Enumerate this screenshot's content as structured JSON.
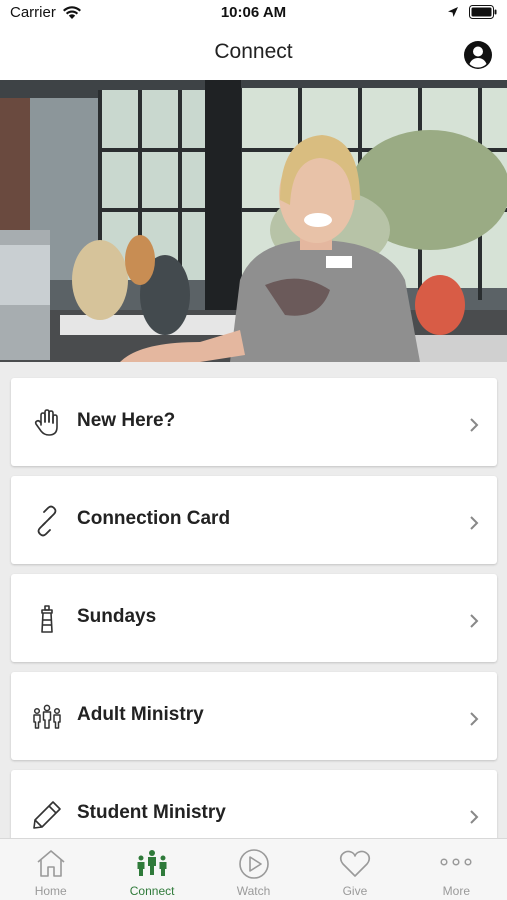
{
  "status": {
    "carrier": "Carrier",
    "time": "10:06 AM"
  },
  "header": {
    "title": "Connect"
  },
  "cards": [
    {
      "label": "New Here?",
      "icon": "hand-icon"
    },
    {
      "label": "Connection Card",
      "icon": "link-icon"
    },
    {
      "label": "Sundays",
      "icon": "lighthouse-icon"
    },
    {
      "label": "Adult Ministry",
      "icon": "people-group-icon"
    },
    {
      "label": "Student Ministry",
      "icon": "pencil-icon"
    }
  ],
  "tabs": [
    {
      "label": "Home",
      "icon": "home-icon",
      "active": false
    },
    {
      "label": "Connect",
      "icon": "connect-people-icon",
      "active": true
    },
    {
      "label": "Watch",
      "icon": "play-icon",
      "active": false
    },
    {
      "label": "Give",
      "icon": "heart-icon",
      "active": false
    },
    {
      "label": "More",
      "icon": "more-dots-icon",
      "active": false
    }
  ],
  "colors": {
    "accent": "#2f7a3a",
    "inactive": "#9a9a9a",
    "background": "#ececec"
  }
}
